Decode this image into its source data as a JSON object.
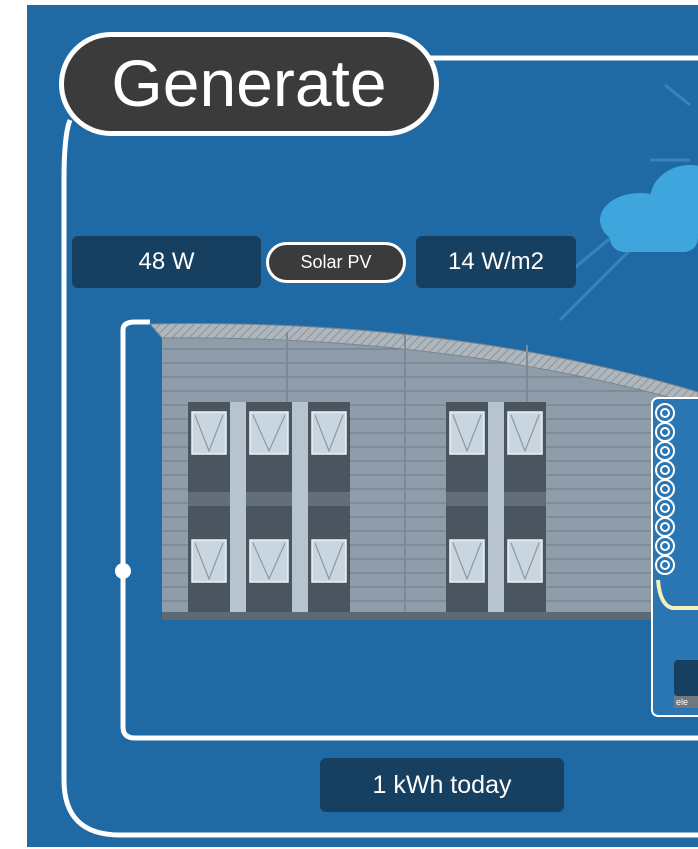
{
  "panel": {
    "title": "Generate"
  },
  "generation": {
    "power": "48 W",
    "source": "Solar PV",
    "irradiance": "14 W/m2",
    "energy_today": "1 kWh today"
  },
  "inverter": {
    "label": "ele"
  },
  "colors": {
    "background": "#1f6aa5",
    "stat_box": "#173f60",
    "title_pill": "#3b3b3b",
    "cloud": "#3fa6dd",
    "building": "#8c9aa8",
    "window_frame": "#4a5560",
    "window_glass": "#c9d6df",
    "flow_line": "#f3efbf"
  },
  "icons": {
    "cloud": "cloud-icon",
    "pv_coil": "coil-icon"
  }
}
